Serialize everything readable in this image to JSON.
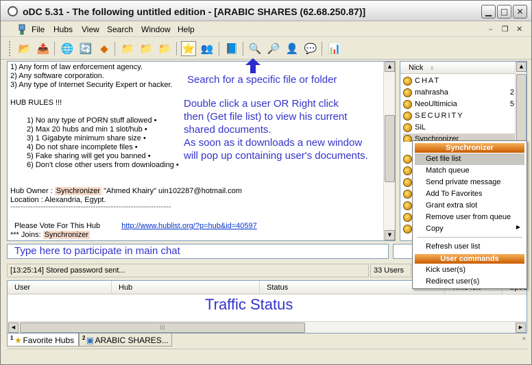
{
  "window": {
    "title": "oDC 5.31 - The following untitled edition - [ARABIC SHARES (62.68.250.87)]",
    "buttons": {
      "minimize": "▁",
      "maximize": "□",
      "close": "✕"
    }
  },
  "menubar": {
    "items": [
      "File",
      "Hubs",
      "View",
      "Search",
      "Window",
      "Help"
    ],
    "mdi_buttons": {
      "minimize": "–",
      "restore": "❐",
      "close": "✕"
    }
  },
  "toolbar": {
    "buttons": [
      {
        "icon": "open-folder-icon",
        "glyph": "📂"
      },
      {
        "icon": "reconnect-icon",
        "glyph": "📤"
      },
      {
        "icon": "network-icon",
        "glyph": "🌐"
      },
      {
        "icon": "refresh-icon",
        "glyph": "🔄"
      },
      {
        "icon": "follow-redirect-icon",
        "glyph": "◆"
      },
      {
        "icon": "folder-icon",
        "glyph": "📁"
      },
      {
        "icon": "folder-icon",
        "glyph": "📁"
      },
      {
        "icon": "folder-icon",
        "glyph": "📁"
      },
      {
        "icon": "favorites-star-icon",
        "glyph": "⭐"
      },
      {
        "icon": "favorite-users-icon",
        "glyph": "👥"
      },
      {
        "icon": "notepad-icon",
        "glyph": "📘"
      },
      {
        "icon": "search-icon",
        "glyph": "🔍"
      },
      {
        "icon": "adl-search-icon",
        "glyph": "🔎"
      },
      {
        "icon": "spy-icon",
        "glyph": "👤"
      },
      {
        "icon": "messages-icon",
        "glyph": "💬"
      },
      {
        "icon": "network-stats-icon",
        "glyph": "📊"
      }
    ]
  },
  "chat": {
    "lines": [
      {
        "text": "1) Any form of law enforcement agency."
      },
      {
        "text": "2) Any software corporation."
      },
      {
        "text": "3) Any type of Internet Security Expert or hacker."
      },
      {
        "text": ""
      },
      {
        "text": "HUB RULES !!!"
      },
      {
        "text": ""
      },
      {
        "text": "1)    No any type of PORN stuff allowed •"
      },
      {
        "text": "2)    Max 20 hubs and min 1 slot/hub •"
      },
      {
        "text": "3)    1 Gigabyte minimum share size •"
      },
      {
        "text": "4)    Do not share incomplete files •"
      },
      {
        "text": "5)    Fake sharing will get you banned •"
      },
      {
        "text": "6)    Don't close other users from downloading •"
      }
    ],
    "owner_prefix": "Hub Owner  :  ",
    "owner_name": "Synchronizer",
    "owner_suffix": " \"Ahmed Khairy\"  uin102287@hotmail.com",
    "location": "Location     :  Alexandria, Egypt.",
    "divider": "----------------------------------------------------------------",
    "vote_text": "Please Vote For This Hub",
    "vote_link": "http://www.hublist.org/?p=hub&id=40597",
    "joins_prefix": "*** Joins: ",
    "joins_name": "Synchronizer"
  },
  "userlist": {
    "header": "Nick",
    "header_close": "x",
    "users": [
      {
        "name": "CHAT",
        "share": "",
        "type": "separator"
      },
      {
        "name": "mahrasha",
        "share": "2",
        "type": "user"
      },
      {
        "name": "NeoUltimicia",
        "share": "5",
        "type": "user"
      },
      {
        "name": "SECURITY",
        "share": "",
        "type": "separator"
      },
      {
        "name": "SiL",
        "share": "",
        "type": "user"
      },
      {
        "name": "Synchronizer",
        "share": "",
        "type": "selected"
      }
    ]
  },
  "context_menu": {
    "title": "Synchronizer",
    "items": [
      {
        "label": "Get file list",
        "highlighted": true
      },
      {
        "label": "Match queue"
      },
      {
        "label": "Send private message"
      },
      {
        "label": "Add To Favorites"
      },
      {
        "label": "Grant extra slot"
      },
      {
        "label": "Remove user from queue"
      },
      {
        "label": "Copy",
        "submenu": true
      }
    ],
    "refresh_label": "Refresh user list",
    "user_commands_title": "User commands",
    "user_command_items": [
      {
        "label": "Kick user(s)"
      },
      {
        "label": "Redirect user(s)"
      }
    ]
  },
  "status": {
    "message": "[13:25:14] Stored password sent...",
    "users": "33 Users"
  },
  "transfers": {
    "columns": [
      "User",
      "Hub",
      "Status",
      "Time left",
      "Speed"
    ]
  },
  "tabs": [
    {
      "number": "1",
      "label": "Favorite Hubs",
      "icon": "star-icon"
    },
    {
      "number": "2",
      "label": "ARABIC SHARES...",
      "icon": "hub-icon"
    }
  ],
  "annotations": {
    "search": "Search for a specific file or folder",
    "double_click": [
      "Double click a user OR Right click",
      "then (Get file list) to view his current",
      "shared documents.",
      "As soon as it downloads a new window",
      "will pop up containing user's documents."
    ],
    "input": "Type here to participate in main chat",
    "traffic": "Traffic Status",
    "color": "#3333cc"
  }
}
